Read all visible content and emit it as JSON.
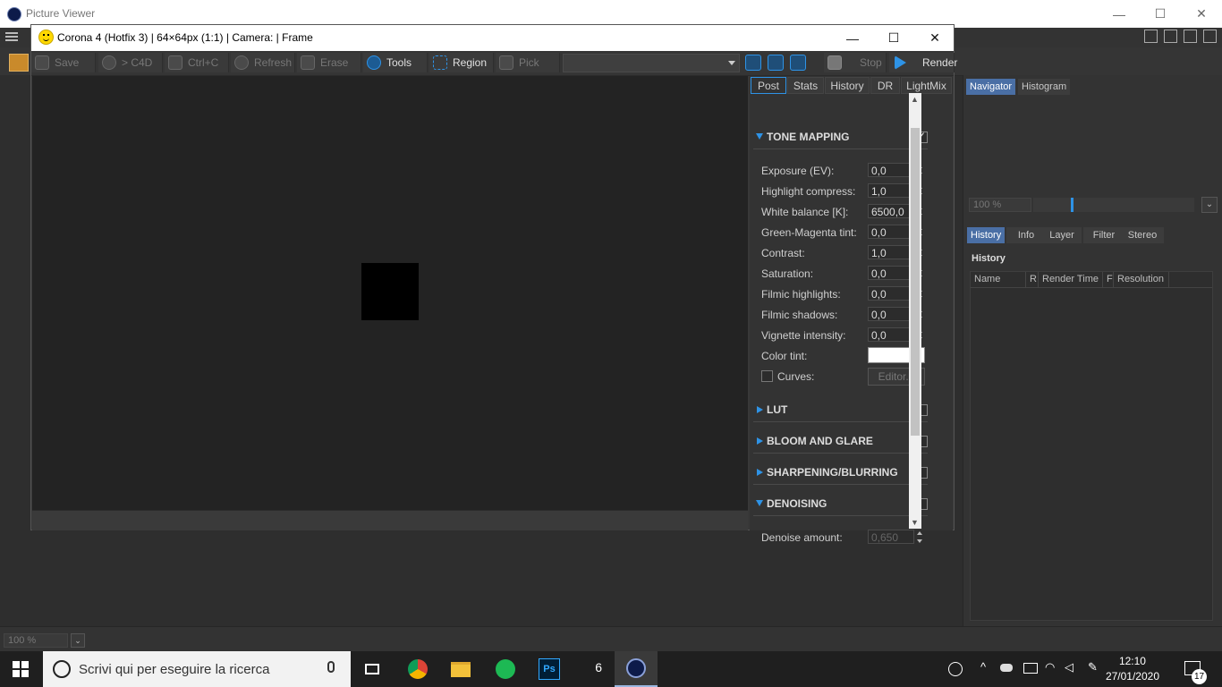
{
  "app": {
    "outer_title": "Picture Viewer",
    "vfb_title": "Corona 4 (Hotfix 3) | 64×64px (1:1) | Camera:  | Frame"
  },
  "toolbar": {
    "save": "Save",
    "to_c4d": "> C4D",
    "ctrl_c": "Ctrl+C",
    "refresh": "Refresh",
    "erase": "Erase",
    "tools": "Tools",
    "region": "Region",
    "pick": "Pick",
    "stop": "Stop",
    "render": "Render"
  },
  "panel_tabs": [
    "Post",
    "Stats",
    "History",
    "DR",
    "LightMix"
  ],
  "tone_mapping": {
    "title": "TONE MAPPING",
    "enabled": true,
    "params": [
      {
        "label": "Exposure (EV):",
        "value": "0,0"
      },
      {
        "label": "Highlight compress:",
        "value": "1,0"
      },
      {
        "label": "White balance [K]:",
        "value": "6500,0"
      },
      {
        "label": "Green-Magenta tint:",
        "value": "0,0"
      },
      {
        "label": "Contrast:",
        "value": "1,0"
      },
      {
        "label": "Saturation:",
        "value": "0,0"
      },
      {
        "label": "Filmic highlights:",
        "value": "0,0"
      },
      {
        "label": "Filmic shadows:",
        "value": "0,0"
      },
      {
        "label": "Vignette intensity:",
        "value": "0,0"
      }
    ],
    "color_tint_label": "Color tint:",
    "color_tint_value": "#ffffff",
    "curves_label": "Curves:",
    "editor_label": "Editor..."
  },
  "sections": {
    "lut": "LUT",
    "bloom": "BLOOM AND GLARE",
    "sharpen": "SHARPENING/BLURRING",
    "denoise": "DENOISING",
    "denoise_amount_label": "Denoise amount:",
    "denoise_amount_value": "0,650"
  },
  "dock": {
    "nav_tabs": [
      "Navigator",
      "Histogram"
    ],
    "nav_zoom": "100 %",
    "lower_tabs": [
      "History",
      "Info",
      "Layer",
      "Filter",
      "Stereo"
    ],
    "history_heading": "History",
    "history_columns": [
      "Name",
      "R",
      "Render Time",
      "F",
      "Resolution"
    ]
  },
  "bottom": {
    "zoom": "100 %"
  },
  "taskbar": {
    "search_placeholder": "Scrivi qui per eseguire la ricerca",
    "time": "12:10",
    "date": "27/01/2020",
    "notifications": "17",
    "ps_label": "Ps",
    "tray_badge": "6"
  },
  "colors": {
    "accent": "#2e93e6",
    "dock_tab_active": "#4a6fa5"
  }
}
